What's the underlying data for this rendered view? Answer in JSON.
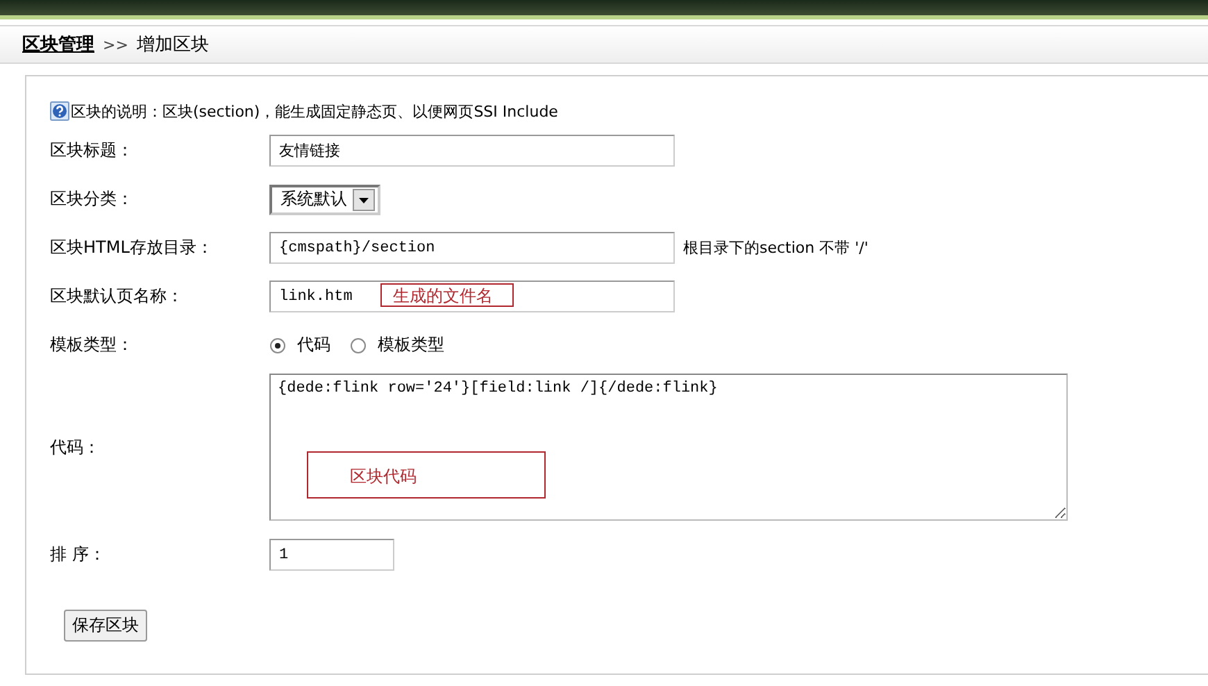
{
  "breadcrumb": {
    "parent": "区块管理",
    "separator": ">>",
    "current": "增加区块"
  },
  "note": {
    "text": "区块的说明：区块(section)，能生成固定静态页、以便网页SSI Include"
  },
  "fields": [
    {
      "kind": "text",
      "label": "区块标题：",
      "value": "友情链接"
    },
    {
      "kind": "select",
      "label": "区块分类：",
      "value": "系统默认"
    },
    {
      "kind": "text",
      "label": "区块HTML存放目录：",
      "value": "{cmspath}/section",
      "hint": "根目录下的section 不带 '/'"
    },
    {
      "kind": "text",
      "label": "区块默认页名称：",
      "value": "link.htm",
      "annotation": "生成的文件名"
    },
    {
      "kind": "radio",
      "label": "模板类型：",
      "options": [
        {
          "label": "代码",
          "selected": true
        },
        {
          "label": "模板类型",
          "selected": false
        }
      ]
    },
    {
      "kind": "textarea",
      "label": "代码：",
      "value": "{dede:flink row='24'}[field:link /]{/dede:flink}",
      "annotation": "区块代码"
    },
    {
      "kind": "short",
      "label": "排 序：",
      "value": "1"
    }
  ],
  "buttons": [
    "保存区块"
  ]
}
